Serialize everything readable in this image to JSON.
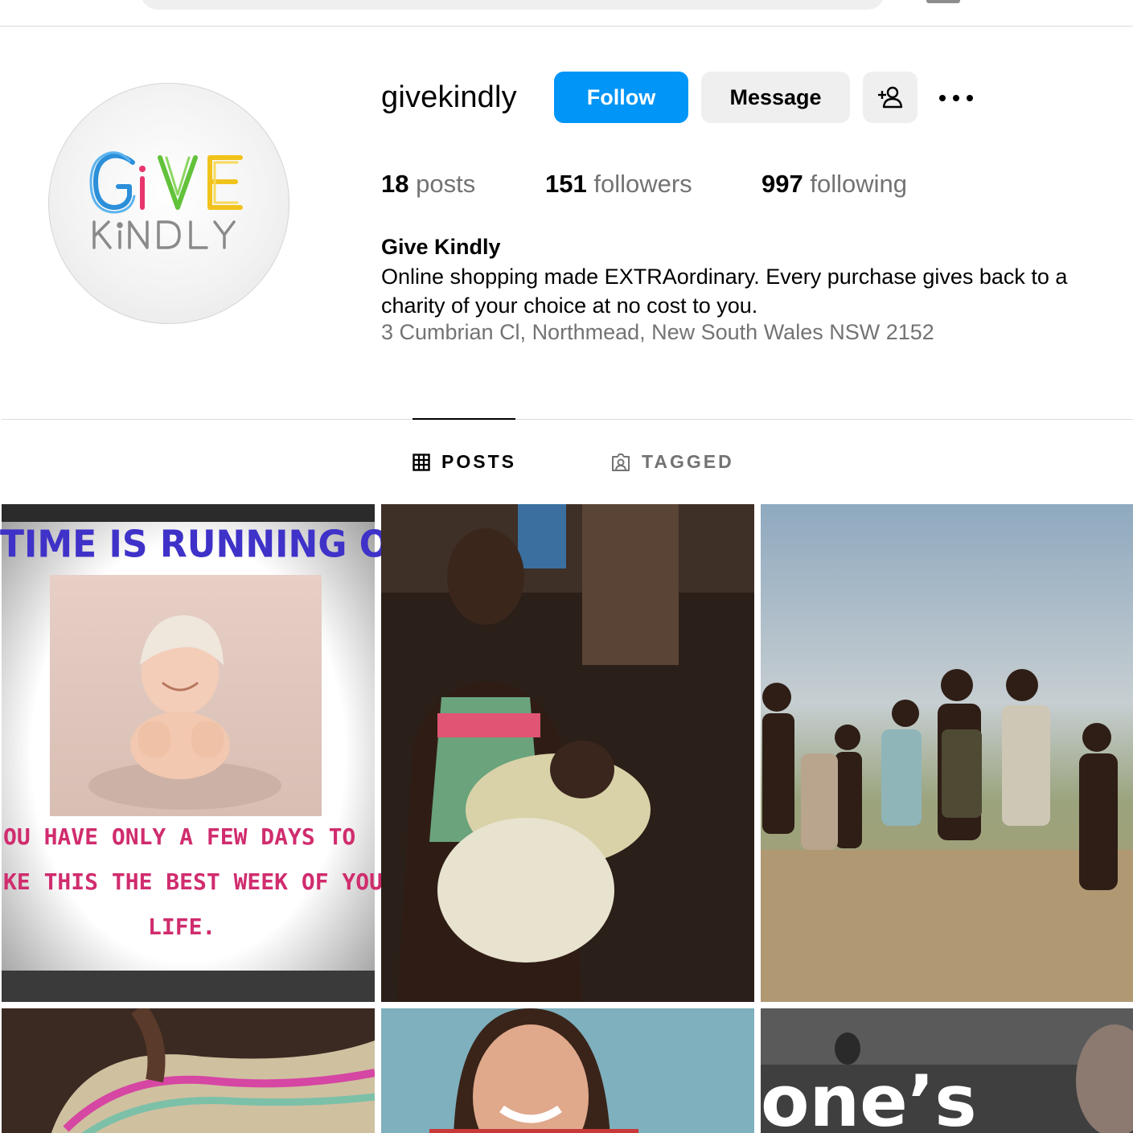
{
  "profile": {
    "username": "givekindly",
    "avatar_logo_text": "GiVE KiNDLY",
    "follow_label": "Follow",
    "message_label": "Message",
    "add_user_icon": "add-person-icon",
    "more_icon": "more-dots-icon"
  },
  "stats": {
    "posts_count": "18",
    "posts_label": "posts",
    "followers_count": "151",
    "followers_label": "followers",
    "following_count": "997",
    "following_label": "following"
  },
  "bio": {
    "name": "Give Kindly",
    "text": "Online shopping made EXTRAordinary. Every purchase gives back to a charity of your choice at no cost to you.",
    "address": "3 Cumbrian Cl, Northmead, New South Wales NSW 2152"
  },
  "tabs": [
    {
      "label": "POSTS",
      "icon": "grid-icon",
      "active": true
    },
    {
      "label": "TAGGED",
      "icon": "tagged-person-icon",
      "active": false
    }
  ],
  "posts": [
    {
      "kind": "text-graphic",
      "title": "TIME IS RUNNING OUT",
      "lines": [
        "OU HAVE ONLY A FEW DAYS TO",
        "KE THIS THE BEST WEEK OF YOU",
        "LIFE."
      ]
    },
    {
      "kind": "photo"
    },
    {
      "kind": "photo"
    },
    {
      "kind": "photo"
    },
    {
      "kind": "photo"
    },
    {
      "kind": "photo",
      "caption": "one’s"
    }
  ],
  "colors": {
    "follow_button": "#0095f6",
    "secondary_button": "#efefef",
    "muted_text": "#737373",
    "divider": "#dbdbdb",
    "post1_title": "#3f32c8",
    "post1_body": "#d02c6e"
  }
}
